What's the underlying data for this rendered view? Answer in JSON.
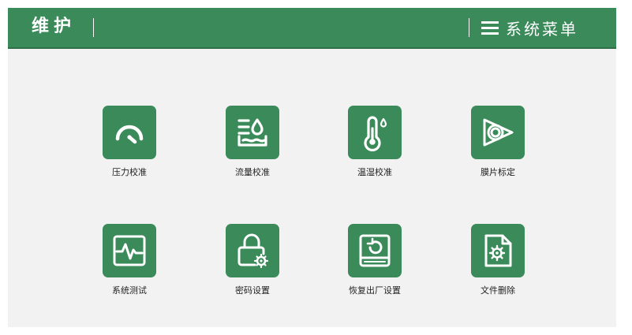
{
  "header": {
    "title": "维护",
    "menu_label": "系统菜单",
    "background_color": "#3a8a5a"
  },
  "tiles": [
    {
      "label": "压力校准",
      "icon": "gauge-icon"
    },
    {
      "label": "流量校准",
      "icon": "flow-icon"
    },
    {
      "label": "温湿校准",
      "icon": "thermometer-icon"
    },
    {
      "label": "膜片标定",
      "icon": "diaphragm-icon"
    },
    {
      "label": "系统测试",
      "icon": "waveform-monitor-icon"
    },
    {
      "label": "密码设置",
      "icon": "lock-gear-icon"
    },
    {
      "label": "恢复出厂设置",
      "icon": "restore-drive-icon"
    },
    {
      "label": "文件删除",
      "icon": "file-gear-icon"
    }
  ]
}
